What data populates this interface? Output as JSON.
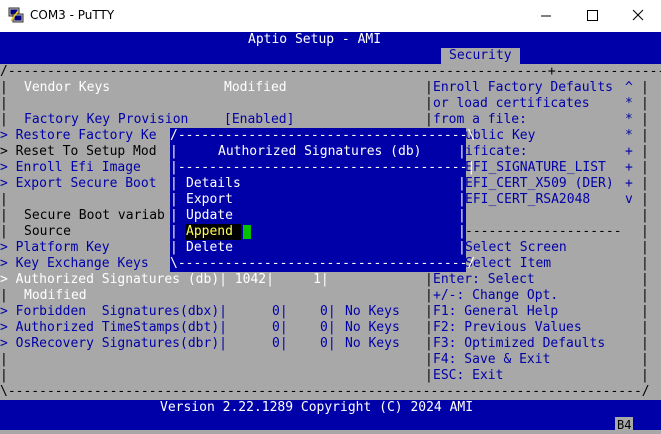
{
  "window": {
    "title": "COM3 - PuTTY",
    "icons": {
      "app": "putty-icon",
      "minimize": "minimize-icon",
      "maximize": "maximize-icon",
      "close": "close-icon"
    }
  },
  "header": {
    "title": "Aptio Setup - AMI",
    "active_tab": "Security"
  },
  "left_panel": {
    "top_border": "/---------------------------------------------------------------------+----------------------\\",
    "vendor_keys": {
      "label": "Vendor Keys",
      "value": "Modified"
    },
    "factory_key_provision": {
      "label": "Factory Key Provision",
      "value": "[Enabled]"
    },
    "menu_items": [
      "> Restore Factory Ke",
      "> Reset To Setup Mod",
      "> Enroll Efi Image",
      "> Export Secure Boot"
    ],
    "secure_boot_variable_header": "Secure Boot variab",
    "source_label": "Source",
    "key_items": [
      "> Platform Key",
      "> Key Exchange Keys"
    ],
    "authorized_signatures_row": "> Authorized Signatures (db)| 1042|     1|",
    "modified_label": "Modified",
    "rows": [
      {
        "name": "> Forbidden  Signatures(dbx)|",
        "size": "0|",
        "count": "0|",
        "status": "No Keys"
      },
      {
        "name": "> Authorized TimeStamps(dbt)|",
        "size": "0|",
        "count": "0|",
        "status": "No Keys"
      },
      {
        "name": "> OsRecovery Signatures(dbr)|",
        "size": "0|",
        "count": "0|",
        "status": "No Keys"
      }
    ]
  },
  "help_panel": {
    "lines": [
      "Enroll Factory Defaults",
      "or load certificates",
      "from a file:",
      "ublic Key",
      "ificate:",
      "EFI_SIGNATURE_LIST",
      "EFI_CERT_X509 (DER)",
      "EFI_CERT_RSA2048"
    ],
    "scroll_marks": [
      "^",
      "*",
      "*",
      "*",
      "+",
      "+",
      "+",
      "v"
    ],
    "nav": [
      "Select Screen",
      "Select Item",
      "Enter: Select",
      "+/-: Change Opt.",
      "F1: General Help",
      "F2: Previous Values",
      "F3: Optimized Defaults",
      "F4: Save & Exit",
      "ESC: Exit"
    ]
  },
  "popup": {
    "title": "Authorized Signatures (db)",
    "options": [
      "Details",
      "Export",
      "Update",
      "Append",
      "Delete"
    ],
    "selected": "Append"
  },
  "footer": {
    "version": "Version 2.22.1289 Copyright (C) 2024 AMI",
    "badge": "B4"
  },
  "colors": {
    "terminal_bg": "#000000",
    "bios_blue": "#0000a8",
    "bios_gray": "#a8a8a8",
    "text_white": "#ffffff",
    "highlight_yellow": "#ffff55",
    "cursor_green": "#00c000"
  }
}
